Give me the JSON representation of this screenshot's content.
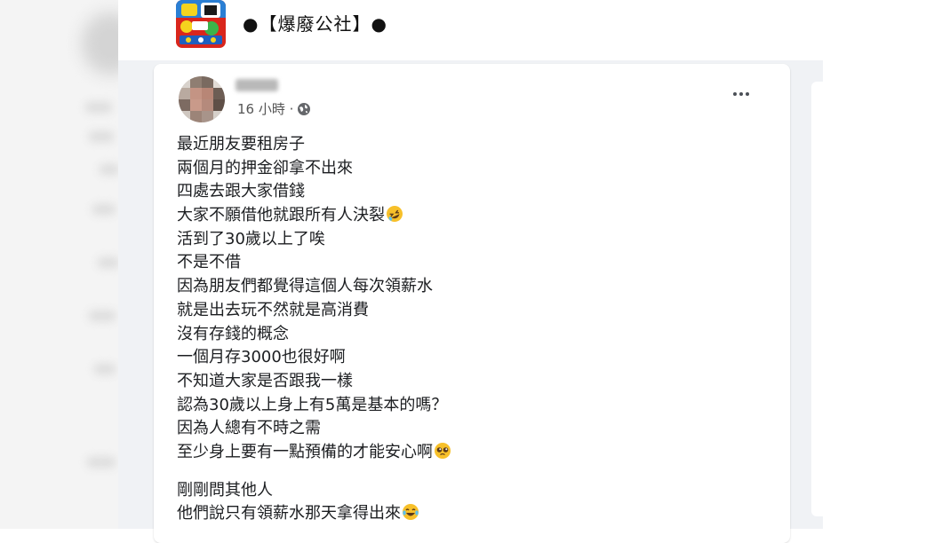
{
  "group": {
    "name": "●【爆廢公社】●",
    "logo_icon": "bao-fei-gong-she-logo",
    "brand_color": "#e02020"
  },
  "post": {
    "time_label": "16 小時 ·",
    "privacy_icon": "globe-icon",
    "more_icon": "more-options-icon",
    "paragraphs": [
      {
        "lines": [
          {
            "text": "最近朋友要租房子"
          },
          {
            "text": "兩個月的押金卻拿不出來"
          },
          {
            "text": "四處去跟大家借錢"
          },
          {
            "text": "大家不願借他就跟所有人決裂",
            "emoji": "rolling-laughing-emoji"
          },
          {
            "text": "活到了30歲以上了唉"
          },
          {
            "text": "不是不借"
          },
          {
            "text": "因為朋友們都覺得這個人每次領薪水"
          },
          {
            "text": "就是出去玩不然就是高消費"
          },
          {
            "text": "沒有存錢的概念"
          },
          {
            "text": "一個月存3000也很好啊"
          },
          {
            "text": "不知道大家是否跟我一樣"
          },
          {
            "text": "認為30歲以上身上有5萬是基本的嗎？"
          },
          {
            "text": "因為人總有不時之需"
          },
          {
            "text": "至少身上要有一點預備的才能安心啊",
            "emoji": "pleading-face-emoji"
          }
        ]
      },
      {
        "lines": [
          {
            "text": "剛剛問其他人"
          },
          {
            "text": "他們說只有領薪水那天拿得出來",
            "emoji": "tears-of-joy-emoji"
          }
        ]
      }
    ]
  }
}
